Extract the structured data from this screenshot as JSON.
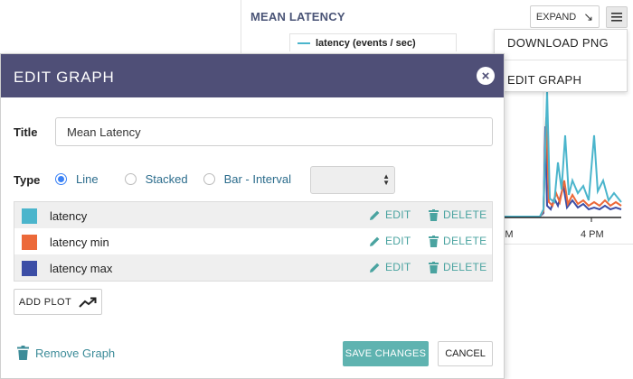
{
  "graph_card": {
    "title": "MEAN LATENCY",
    "expand_label": "EXPAND",
    "legend_label": "latency (events / sec)",
    "x_ticks": [
      "PM",
      "4 PM"
    ]
  },
  "menu": {
    "download_png": "DOWNLOAD PNG",
    "edit_graph": "EDIT GRAPH"
  },
  "modal": {
    "header_title": "EDIT GRAPH",
    "title_label": "Title",
    "title_value": "Mean Latency",
    "type_label": "Type",
    "type_options": [
      "Line",
      "Stacked",
      "Bar - Interval"
    ],
    "selected_type": "Line",
    "interval_select_value": "",
    "plots": [
      {
        "name": "latency",
        "color": "#4bb5cc"
      },
      {
        "name": "latency min",
        "color": "#ec6939"
      },
      {
        "name": "latency max",
        "color": "#3c4ea6"
      }
    ],
    "edit_label": "EDIT",
    "delete_label": "DELETE",
    "add_plot_label": "ADD PLOT",
    "remove_graph_label": "Remove Graph",
    "save_label": "SAVE CHANGES",
    "cancel_label": "CANCEL"
  },
  "colors": {
    "header_bg": "#4f4f77",
    "accent_teal": "#5fb3b0",
    "link_teal": "#4aa3a0",
    "radio_blue": "#3b82f6"
  }
}
